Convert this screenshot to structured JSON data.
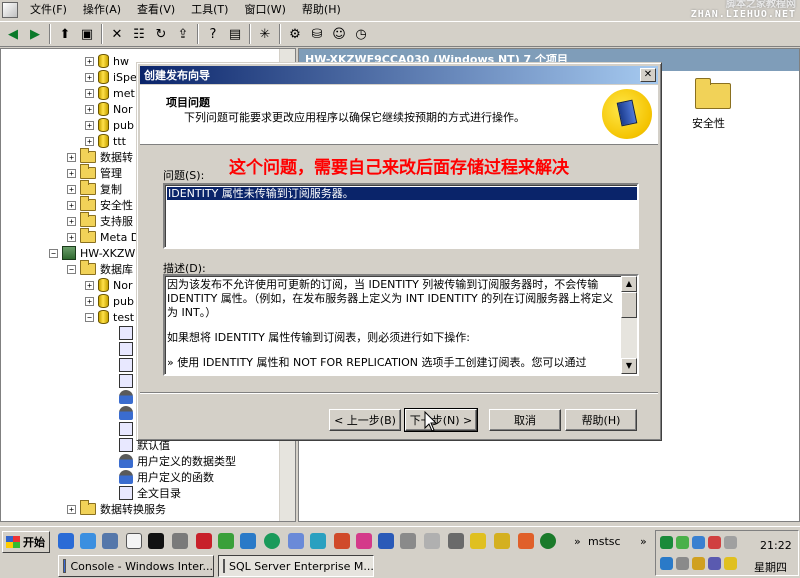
{
  "menubar": {
    "items": [
      "文件(F)",
      "操作(A)",
      "查看(V)",
      "工具(T)",
      "窗口(W)",
      "帮助(H)"
    ]
  },
  "watermark": {
    "line1": "脚本之家教程网",
    "line2": "ZHAN.LIEHUO.NET"
  },
  "tree": {
    "items": [
      {
        "label": "hw",
        "icon": "database-icon"
      },
      {
        "label": "iSpe",
        "icon": "database-icon"
      },
      {
        "label": "met",
        "icon": "database-icon"
      },
      {
        "label": "Nor",
        "icon": "database-icon"
      },
      {
        "label": "pub",
        "icon": "database-icon"
      },
      {
        "label": "ttt",
        "icon": "database-icon"
      },
      {
        "label": "数据转",
        "icon": "folder-icon"
      },
      {
        "label": "管理",
        "icon": "folder-icon"
      },
      {
        "label": "复制",
        "icon": "folder-icon"
      },
      {
        "label": "安全性",
        "icon": "folder-icon"
      },
      {
        "label": "支持服",
        "icon": "folder-icon"
      },
      {
        "label": "Meta Da",
        "icon": "folder-icon"
      },
      {
        "label": "HW-XKZWF",
        "icon": "server-icon"
      },
      {
        "label": "数据库",
        "icon": "folder-icon"
      },
      {
        "label": "Nor",
        "icon": "database-icon"
      },
      {
        "label": "pub",
        "icon": "database-icon"
      },
      {
        "label": "test",
        "icon": "database-icon"
      },
      {
        "label": "默认值",
        "icon": "object-icon"
      },
      {
        "label": "用户定义的数据类型",
        "icon": "user-type-icon"
      },
      {
        "label": "用户定义的函数",
        "icon": "function-icon"
      },
      {
        "label": "全文目录",
        "icon": "catalog-icon"
      },
      {
        "label": "数据转换服务",
        "icon": "folder-icon"
      }
    ]
  },
  "right_pane": {
    "header": "HW-XKZWF9CCA030 (Windows NT)    7 个项目",
    "items": [
      {
        "label": "安全性",
        "icon": "folder-icon"
      }
    ]
  },
  "dialog": {
    "title": "创建发布向导",
    "header_title": "项目问题",
    "header_subtitle": "下列问题可能要求更改应用程序以确保它继续按预期的方式进行操作。",
    "annotation": "这个问题，需要自己来改后面存储过程来解决",
    "issues_label": "问题(S):",
    "issues": [
      "IDENTITY 属性未传输到订阅服务器。"
    ],
    "description_label": "描述(D):",
    "description": [
      "因为该发布不允许使用可更新的订阅，当 IDENTITY 列被传输到订阅服务器时，不会传输 IDENTITY 属性。（例如，在发布服务器上定义为 INT IDENTITY 的列在订阅服务器上将定义为 INT。）",
      "如果想将 IDENTITY 属性传输到订阅表，则必须进行如下操作:",
      "» 使用 IDENTITY 属性和 NOT FOR REPLICATION 选项手工创建订阅表。您可以通过"
    ],
    "buttons": {
      "back": "< 上一步(B)",
      "next": "下一步(N) >",
      "cancel": "取消",
      "help": "帮助(H)"
    }
  },
  "taskbar": {
    "start": "开始",
    "mstsc": "mstsc",
    "tasks": [
      {
        "label": "Console - Windows Inter..."
      },
      {
        "label": "SQL Server Enterprise M..."
      }
    ],
    "clock": {
      "time": "21:22",
      "day": "星期四"
    }
  }
}
